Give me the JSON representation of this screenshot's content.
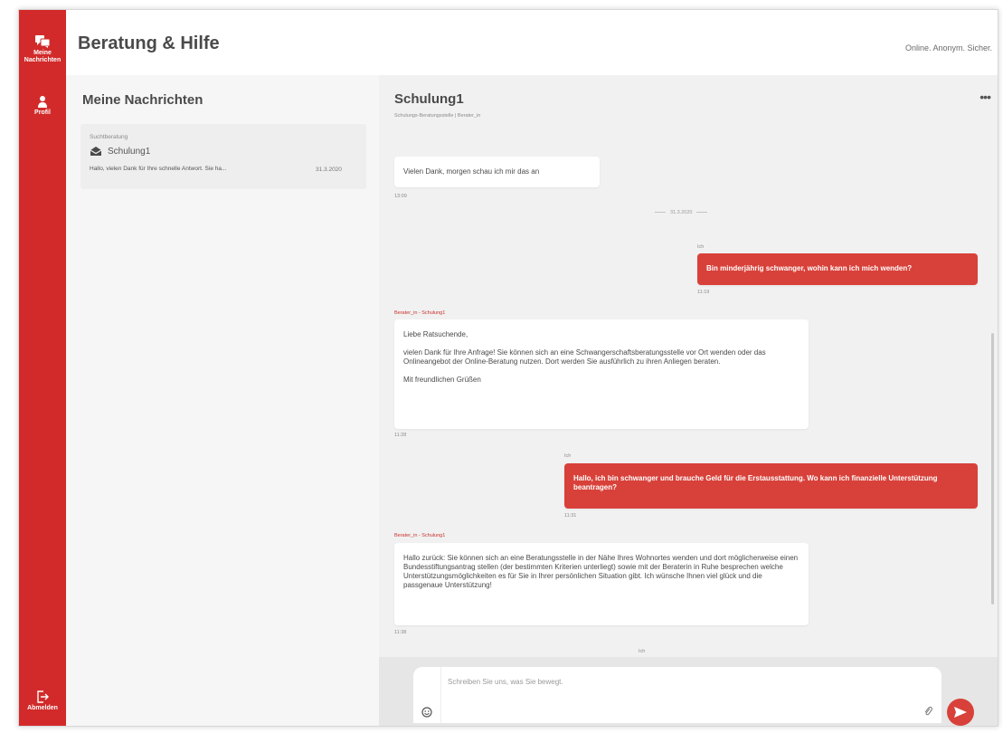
{
  "sidebar": {
    "messages_label": "Meine\nNachrichten",
    "profile_label": "Profil",
    "logout_label": "Abmelden"
  },
  "header": {
    "title": "Beratung & Hilfe",
    "claim": "Online. Anonym. Sicher."
  },
  "list": {
    "title": "Meine Nachrichten",
    "items": [
      {
        "topic": "Suchtberatung",
        "name": "Schulung1",
        "preview": "Hallo, vielen Dank für Ihre schnelle Antwort. Sie ha...",
        "date": "31.3.2020"
      }
    ]
  },
  "chat": {
    "title": "Schulung1",
    "subtitle": "Schulungs-Beratungsstelle  |  Berater_in",
    "menu_label": "•••",
    "date_separator": "31.3.2020",
    "messages": [
      {
        "sender": "",
        "text": [
          "Vielen Dank, morgen schau ich mir das an"
        ],
        "time": "13:09",
        "own": false
      },
      {
        "sender": "Ich",
        "text": [
          "Bin minderjährig schwanger, wohin kann ich mich wenden?"
        ],
        "time": "11:19",
        "own": true
      },
      {
        "sender": "Berater_in - Schulung1",
        "text": [
          "Liebe Ratsuchende,",
          "vielen Dank für Ihre Anfrage! Sie können sich an eine Schwangerschaftsberatungsstelle vor Ort wenden oder das Onlineangebot der Online-Beratung nutzen. Dort werden Sie ausführlich zu ihren Anliegen beraten.",
          "Mit freundlichen Grüßen"
        ],
        "time": "11:28",
        "own": false
      },
      {
        "sender": "Ich",
        "text": [
          "Hallo, ich bin schwanger und brauche Geld für die Erstausstattung. Wo kann ich finanzielle Unterstützung beantragen?"
        ],
        "time": "11:31",
        "own": true
      },
      {
        "sender": "Berater_in - Schulung1",
        "text": [
          "Hallo zurück: Sie können sich an eine Beratungsstelle in der Nähe Ihres Wohnortes wenden und dort möglicherweise einen Bundesstiftungsantrag stellen (der bestimmten Kriterien unterliegt) sowie mit der Beraterin in Ruhe besprechen welche Unterstützungsmöglichkeiten es für Sie in Ihrer persönlichen Situation gibt. Ich wünsche Ihnen viel glück und die passgenaue Unterstützung!"
        ],
        "time": "11:38",
        "own": false
      },
      {
        "sender": "Ich",
        "text": [],
        "time": "",
        "own": true
      }
    ]
  },
  "composer": {
    "placeholder": "Schreiben Sie uns, was Sie bewegt."
  },
  "colors": {
    "brand_red": "#d22a2a",
    "own_bubble": "#d8413a"
  },
  "icons": [
    "messages-icon",
    "profile-icon",
    "logout-icon",
    "envelope-open-icon",
    "emoji-icon",
    "paperclip-icon",
    "send-icon"
  ]
}
